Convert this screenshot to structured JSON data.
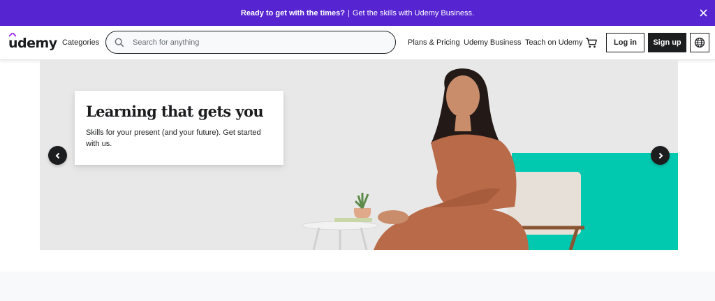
{
  "promo": {
    "strong_text": "Ready to get with the times?",
    "separator": "|",
    "text": "Get the skills with Udemy Business."
  },
  "header": {
    "logo_text": "udemy",
    "categories_label": "Categories",
    "search_placeholder": "Search for anything",
    "nav": {
      "plans": "Plans & Pricing",
      "business": "Udemy Business",
      "teach": "Teach on Udemy"
    },
    "login_label": "Log in",
    "signup_label": "Sign up"
  },
  "hero": {
    "title": "Learning that gets you",
    "subtitle": "Skills for your present (and your future). Get started with us."
  },
  "colors": {
    "brand_purple": "#5624d0",
    "logo_accent": "#a435f0",
    "dark": "#1c1d1f",
    "teal": "#00c9b0"
  },
  "icons": [
    "close-icon",
    "search-icon",
    "cart-icon",
    "globe-icon",
    "chevron-left-icon",
    "chevron-right-icon"
  ]
}
